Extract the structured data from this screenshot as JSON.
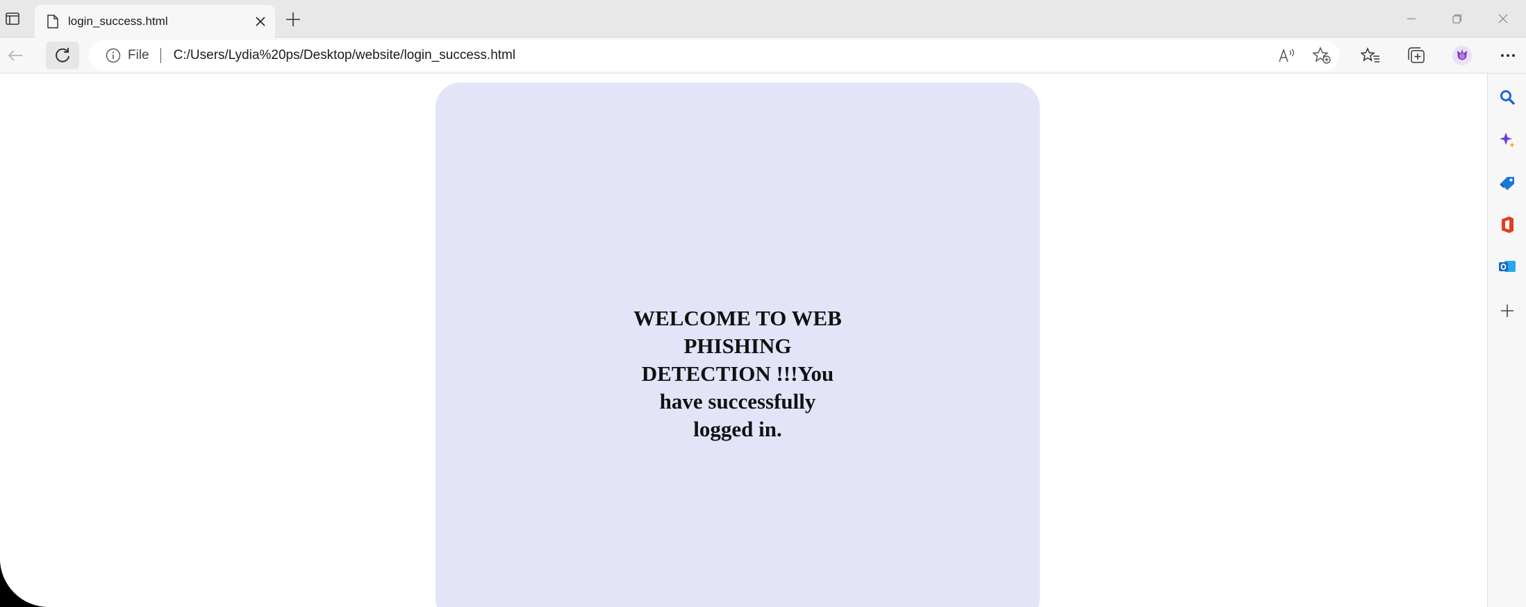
{
  "browser": {
    "tab": {
      "title": "login_success.html"
    },
    "address_bar": {
      "scheme_label": "File",
      "url": "C:/Users/Lydia%20ps/Desktop/website/login_success.html"
    },
    "icons": {
      "tab_actions": "tab-actions-icon",
      "page": "page-icon",
      "close": "close-icon",
      "new_tab": "plus-icon",
      "back": "back-arrow-icon",
      "refresh": "refresh-icon",
      "info": "info-icon",
      "read_aloud": "read-aloud-icon",
      "add_favorite": "add-favorite-icon",
      "favorites": "favorites-icon",
      "collections": "collections-icon",
      "profile": "profile-avatar-icon",
      "more": "more-icon"
    }
  },
  "page": {
    "message": "WELCOME TO WEB PHISHING DETECTION !!!You have successfully logged in."
  },
  "sidebar": {
    "items": [
      "search-icon",
      "copilot-icon",
      "shopping-tag-icon",
      "office-icon",
      "outlook-icon",
      "add-icon"
    ]
  },
  "colors": {
    "card_background": "#e3e4f8",
    "tab_strip": "#e8e8e8",
    "toolbar": "#f7f7f7"
  }
}
